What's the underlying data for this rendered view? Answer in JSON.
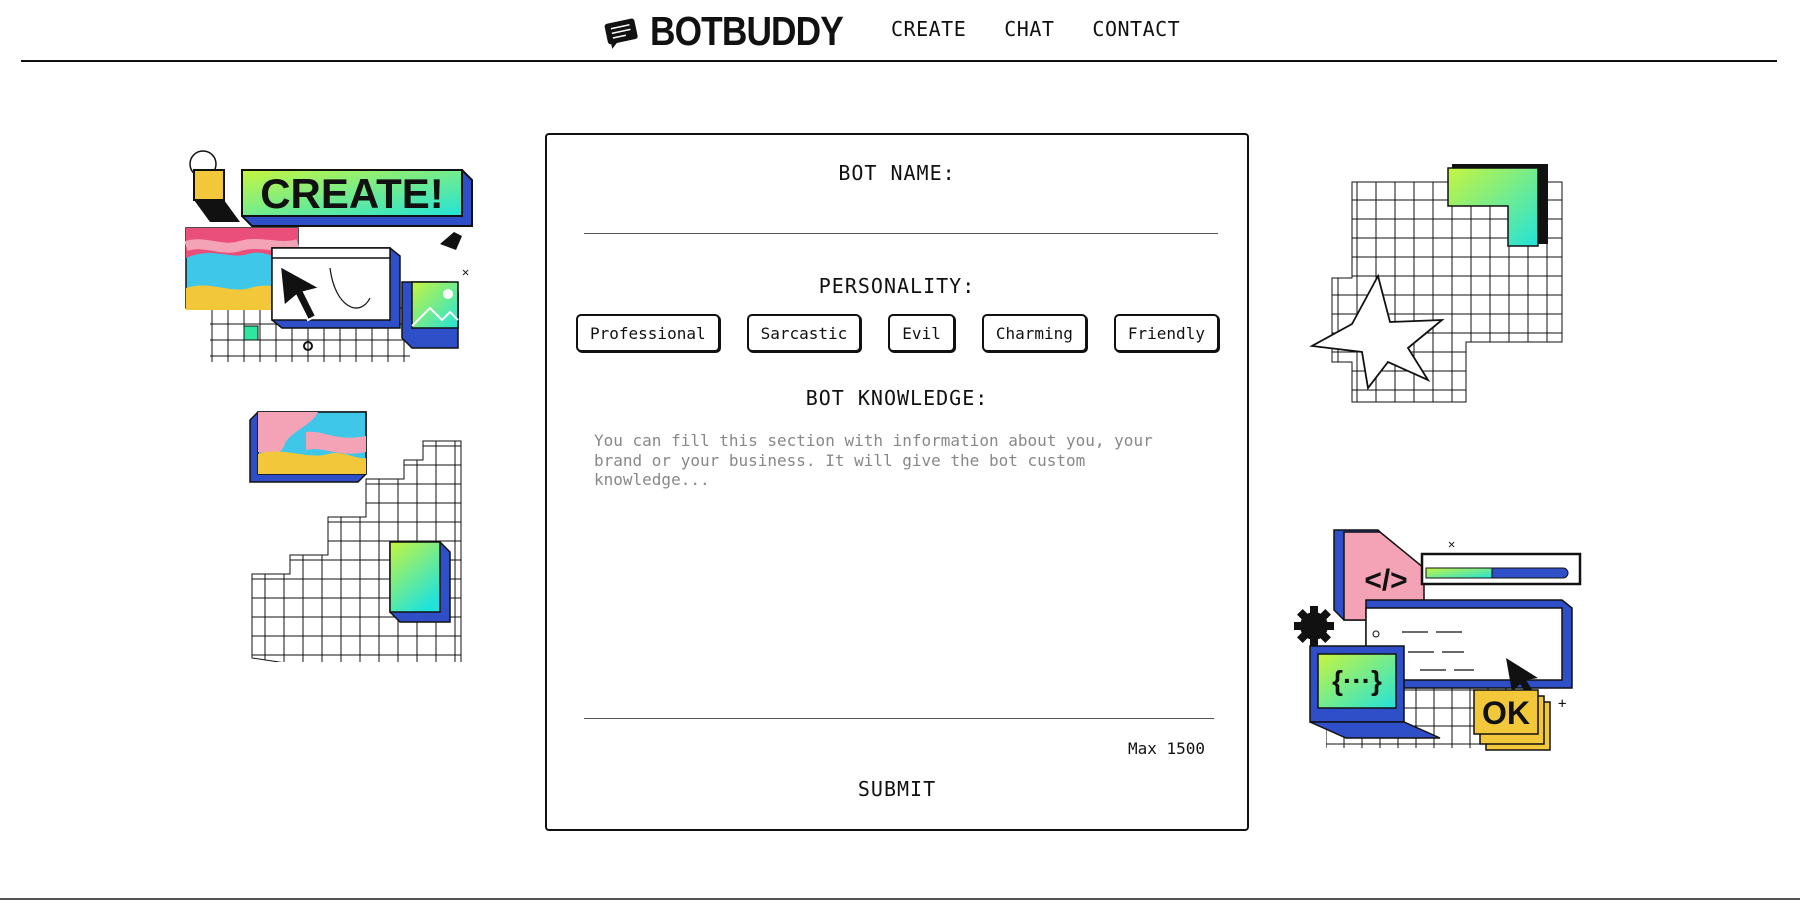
{
  "header": {
    "brand": "BOTBUDDY",
    "nav": [
      {
        "label": "CREATE"
      },
      {
        "label": "CHAT"
      },
      {
        "label": "CONTACT"
      }
    ]
  },
  "form": {
    "bot_name_label": "BOT NAME:",
    "bot_name_value": "",
    "personality_label": "PERSONALITY:",
    "personalities": [
      "Professional",
      "Sarcastic",
      "Evil",
      "Charming",
      "Friendly"
    ],
    "knowledge_label": "BOT KNOWLEDGE:",
    "knowledge_placeholder": "You can fill this section with information about you, your brand or your business. It will give the bot custom knowledge...",
    "max_note": "Max 1500",
    "submit_label": "SUBMIT"
  },
  "illustrations": {
    "create_badge_text": "CREATE!",
    "code_badge_text": "</>",
    "laptop_text": "{···}",
    "ok_badge_text": "OK"
  },
  "colors": {
    "ink": "#111111",
    "blue": "#2f4fc9",
    "pink": "#e94f7a",
    "yellow": "#f2c83a",
    "cyan": "#3ec7e8",
    "green_grad_start": "#b9f24a",
    "green_grad_end": "#2ee6d2"
  }
}
